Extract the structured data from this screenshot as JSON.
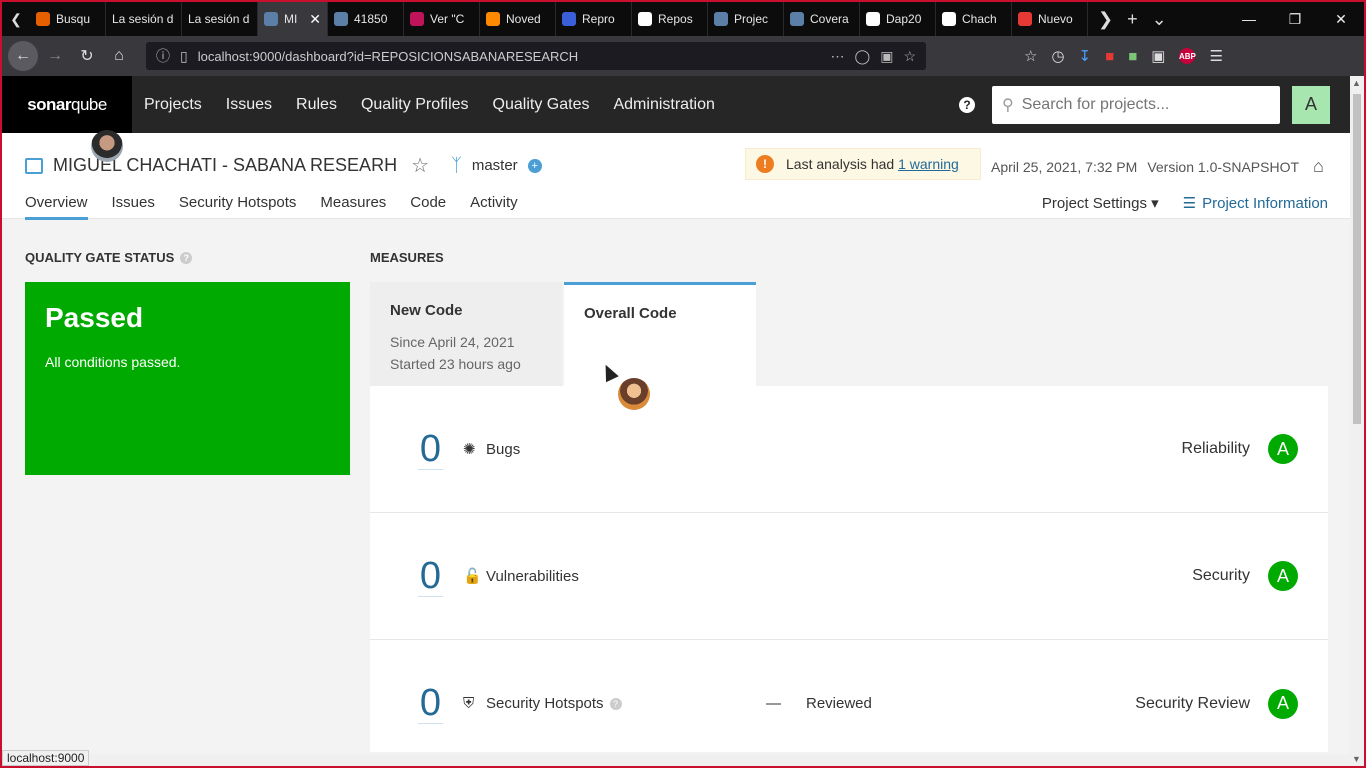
{
  "browser": {
    "tabs": [
      {
        "label": "Busqu",
        "color": "#e66000"
      },
      {
        "label": "La sesión d",
        "color": ""
      },
      {
        "label": "La sesión d",
        "color": ""
      },
      {
        "label": "MI",
        "color": "#5b7fa6",
        "active": true
      },
      {
        "label": "41850",
        "color": "#5b7fa6"
      },
      {
        "label": "Ver \"C",
        "color": "#c0145a"
      },
      {
        "label": "Noved",
        "color": "#ff8a00"
      },
      {
        "label": "Repro",
        "color": "#3b5fd9"
      },
      {
        "label": "Repos",
        "color": "#ffffff"
      },
      {
        "label": "Projec",
        "color": "#5b7fa6"
      },
      {
        "label": "Covera",
        "color": "#5b7fa6"
      },
      {
        "label": "Dap20",
        "color": "#ffffff"
      },
      {
        "label": "Chach",
        "color": "#ffffff"
      },
      {
        "label": "Nuevo",
        "color": "#e53935"
      }
    ],
    "url": "localhost:9000/dashboard?id=REPOSICIONSABANARESEARCH",
    "status_url": "localhost:9000"
  },
  "sonar": {
    "logo_a": "sonar",
    "logo_b": "qube",
    "nav": [
      "Projects",
      "Issues",
      "Rules",
      "Quality Profiles",
      "Quality Gates",
      "Administration"
    ],
    "search_placeholder": "Search for projects...",
    "avatar_letter": "A"
  },
  "project": {
    "name": "MIGUEL CHACHATI - SABANA RESEARH",
    "branch": "master",
    "warning_prefix": "Last analysis had",
    "warning_link": "1 warning",
    "date": "April 25, 2021, 7:32 PM",
    "version": "Version 1.0-SNAPSHOT",
    "tabs": [
      "Overview",
      "Issues",
      "Security Hotspots",
      "Measures",
      "Code",
      "Activity"
    ],
    "settings_label": "Project Settings",
    "info_label": "Project Information"
  },
  "quality_gate": {
    "title": "QUALITY GATE STATUS",
    "status": "Passed",
    "message": "All conditions passed.",
    "color": "#00aa00"
  },
  "measures": {
    "title": "MEASURES",
    "new_code": {
      "title": "New Code",
      "since": "Since April 24, 2021",
      "started": "Started 23 hours ago"
    },
    "overall_title": "Overall Code",
    "rows": [
      {
        "value": "0",
        "label": "Bugs",
        "rating_label": "Reliability",
        "rating": "A"
      },
      {
        "value": "0",
        "label": "Vulnerabilities",
        "rating_label": "Security",
        "rating": "A"
      },
      {
        "value": "0",
        "label": "Security Hotspots",
        "dash": "—",
        "reviewed": "Reviewed",
        "rating_label": "Security Review",
        "rating": "A"
      }
    ]
  }
}
